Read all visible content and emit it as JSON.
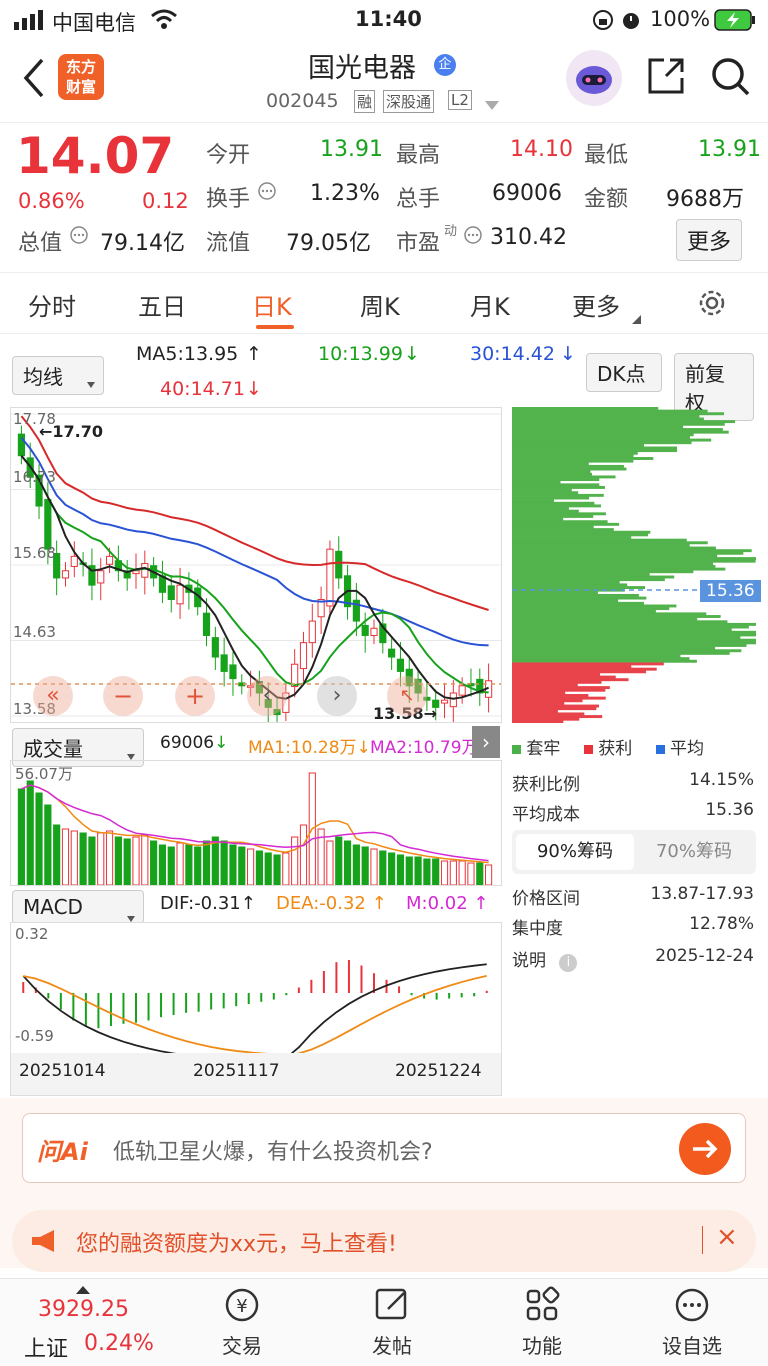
{
  "statusbar": {
    "carrier": "中国电信",
    "time": "11:40",
    "battery": "100%"
  },
  "header": {
    "brand_line1": "东方",
    "brand_line2": "财富",
    "stock_name": "国光电器",
    "stock_code": "002045",
    "tag_rong": "融",
    "tag_sgt": "深股通",
    "tag_l2": "L2"
  },
  "quote": {
    "price": "14.07",
    "pct": "0.86%",
    "change": "0.12",
    "open_label": "今开",
    "open": "13.91",
    "high_label": "最高",
    "high": "14.10",
    "low_label": "最低",
    "low": "13.91",
    "turnover_label": "换手",
    "turnover": "1.23%",
    "volume_label": "总手",
    "volume": "69006",
    "amount_label": "金额",
    "amount": "9688万",
    "mcap_label": "总值",
    "mcap": "79.14亿",
    "float_label": "流值",
    "float": "79.05亿",
    "pe_label": "市盈",
    "pe_sup": "动",
    "pe": "310.42",
    "more_label": "更多"
  },
  "tabs": [
    "分时",
    "五日",
    "日K",
    "周K",
    "月K",
    "更多"
  ],
  "ma_bar": {
    "select": "均线",
    "ma5": "MA5:13.95",
    "ma10": "10:13.99",
    "ma30": "30:14.42",
    "ma40": "40:14.71",
    "dk": "DK点",
    "adjust": "前复权"
  },
  "kline": {
    "tick_top": "17.78",
    "tick_2": "16.73",
    "tick_3": "15.68",
    "tick_4": "14.63",
    "tick_bottom": "13.58",
    "high_mark": "17.70",
    "low_mark": "13.58"
  },
  "chip": {
    "price_tag": "15.36",
    "legend_trapped": "套牢",
    "legend_profit": "获利",
    "legend_avg": "平均",
    "profit_ratio_label": "获利比例",
    "profit_ratio": "14.15%",
    "avg_cost_label": "平均成本",
    "avg_cost": "15.36",
    "tab90": "90%筹码",
    "tab70": "70%筹码",
    "range_label": "价格区间",
    "range": "13.87-17.93",
    "conc_label": "集中度",
    "conc": "12.78%",
    "note_label": "说明",
    "note_date": "2025-12-24"
  },
  "volume": {
    "select": "成交量",
    "vol": "69006",
    "ma1": "MA1:10.28万",
    "ma2": "MA2:10.79万",
    "max_tick": "56.07万"
  },
  "macd": {
    "select": "MACD",
    "dif": "DIF:-0.31",
    "dea": "DEA:-0.32",
    "m": "M:0.02",
    "tick_top": "0.32",
    "tick_bottom": "-0.59"
  },
  "dates": [
    "20251014",
    "20251117",
    "20251224"
  ],
  "ai": {
    "logo": "问Ai",
    "placeholder": "低轨卫星火爆，有什么投资机会?"
  },
  "notice": {
    "text": "您的融资额度为xx元，马上查看!"
  },
  "bottomnav": {
    "index_value": "3929.25",
    "index_name": "上证",
    "index_pct": "0.24%",
    "trade": "交易",
    "post": "发帖",
    "func": "功能",
    "watch": "设自选"
  },
  "chart_data": {
    "type": "candlestick",
    "y_range": [
      13.58,
      17.78
    ],
    "dates_shown": [
      "20251014",
      "20251117",
      "20251224"
    ],
    "close": [
      17.2,
      16.9,
      16.5,
      15.9,
      15.5,
      15.6,
      15.8,
      15.7,
      15.4,
      15.6,
      15.8,
      15.6,
      15.5,
      15.6,
      15.7,
      15.5,
      15.3,
      15.2,
      15.4,
      15.3,
      15.1,
      14.7,
      14.4,
      14.2,
      14.1,
      14.0,
      14.0,
      13.9,
      13.7,
      13.6,
      13.9,
      14.3,
      14.6,
      14.9,
      15.2,
      15.9,
      15.5,
      15.1,
      14.9,
      14.7,
      14.8,
      14.6,
      14.4,
      14.2,
      14.0,
      13.9,
      13.8,
      13.7,
      13.8,
      13.9,
      14.0,
      14.0,
      13.9,
      14.07
    ],
    "volume": [
      48,
      52,
      46,
      40,
      30,
      28,
      27,
      26,
      24,
      26,
      27,
      24,
      23,
      24,
      25,
      22,
      20,
      19,
      21,
      20,
      19,
      22,
      24,
      22,
      20,
      19,
      18,
      17,
      16,
      15,
      16,
      24,
      30,
      56,
      28,
      22,
      24,
      22,
      20,
      19,
      18,
      17,
      16,
      15,
      14,
      14,
      13,
      13,
      12,
      12,
      12,
      11,
      11,
      10
    ],
    "macd_bar": [
      0.1,
      0.05,
      -0.05,
      -0.15,
      -0.25,
      -0.3,
      -0.32,
      -0.3,
      -0.28,
      -0.27,
      -0.25,
      -0.22,
      -0.2,
      -0.18,
      -0.17,
      -0.15,
      -0.14,
      -0.12,
      -0.1,
      -0.08,
      -0.06,
      -0.02,
      0.05,
      0.12,
      0.2,
      0.28,
      0.3,
      0.25,
      0.18,
      0.12,
      0.06,
      -0.02,
      -0.05,
      -0.06,
      -0.05,
      -0.04,
      -0.03,
      0.02
    ]
  }
}
